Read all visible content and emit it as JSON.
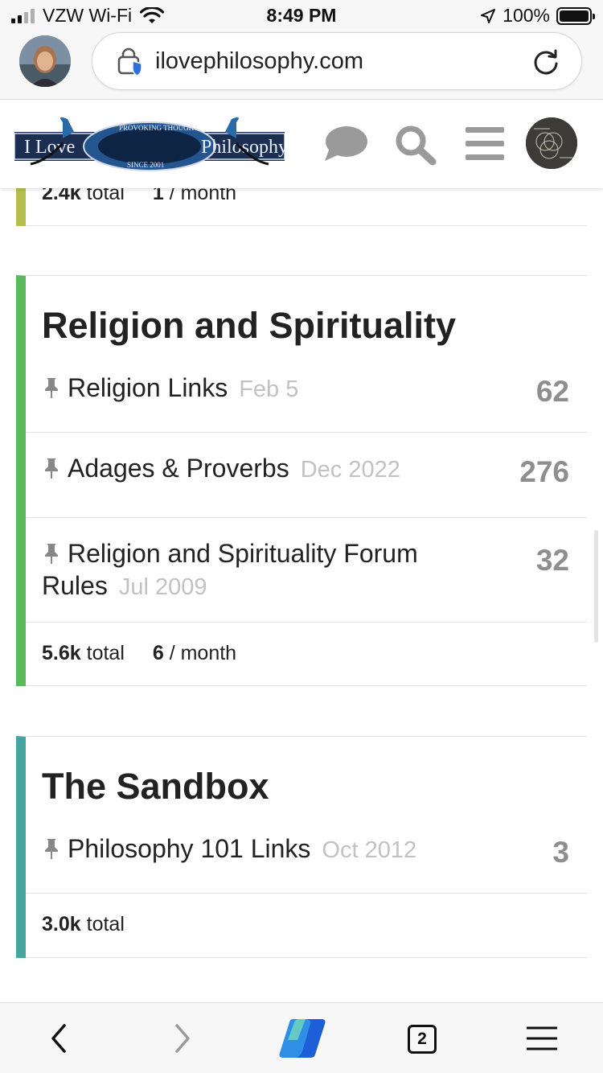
{
  "status_bar": {
    "carrier": "VZW Wi-Fi",
    "time": "8:49 PM",
    "battery": "100%"
  },
  "browser": {
    "url": "ilovephilosophy.com",
    "open_tabs": "2"
  },
  "site": {
    "logo_left": "I Love",
    "logo_right": "Philosophy",
    "logo_top": "PROVOKING THOUGHT",
    "logo_bottom": "SINCE 2001"
  },
  "prev_category": {
    "total_value": "2.4k",
    "total_label": "total",
    "monthly_value": "1",
    "monthly_label": "/ month",
    "accent": "#b4bf4c"
  },
  "categories": [
    {
      "title": "Religion and Spirituality",
      "accent": "#5cb85c",
      "topics": [
        {
          "title": "Religion Links",
          "date": "Feb 5",
          "count": "62"
        },
        {
          "title": "Adages & Proverbs",
          "date": "Dec 2022",
          "count": "276"
        },
        {
          "title": "Religion and Spirituality Forum",
          "title_cont": "Rules",
          "date": "Jul 2009",
          "count": "32"
        }
      ],
      "total_value": "5.6k",
      "total_label": "total",
      "monthly_value": "6",
      "monthly_label": "/ month"
    },
    {
      "title": "The Sandbox",
      "accent": "#45a6a0",
      "topics": [
        {
          "title": "Philosophy 101 Links",
          "date": "Oct 2012",
          "count": "3"
        }
      ],
      "total_value": "3.0k",
      "total_label": "total"
    }
  ],
  "icons": {
    "chat": "chat-bubble-icon",
    "search": "search-icon",
    "menu": "hamburger-menu-icon",
    "pin": "pin-icon",
    "lock": "shield-lock-icon",
    "reload": "reload-icon",
    "back": "chevron-left-icon",
    "forward": "chevron-right-icon",
    "copilot": "copilot-icon"
  }
}
